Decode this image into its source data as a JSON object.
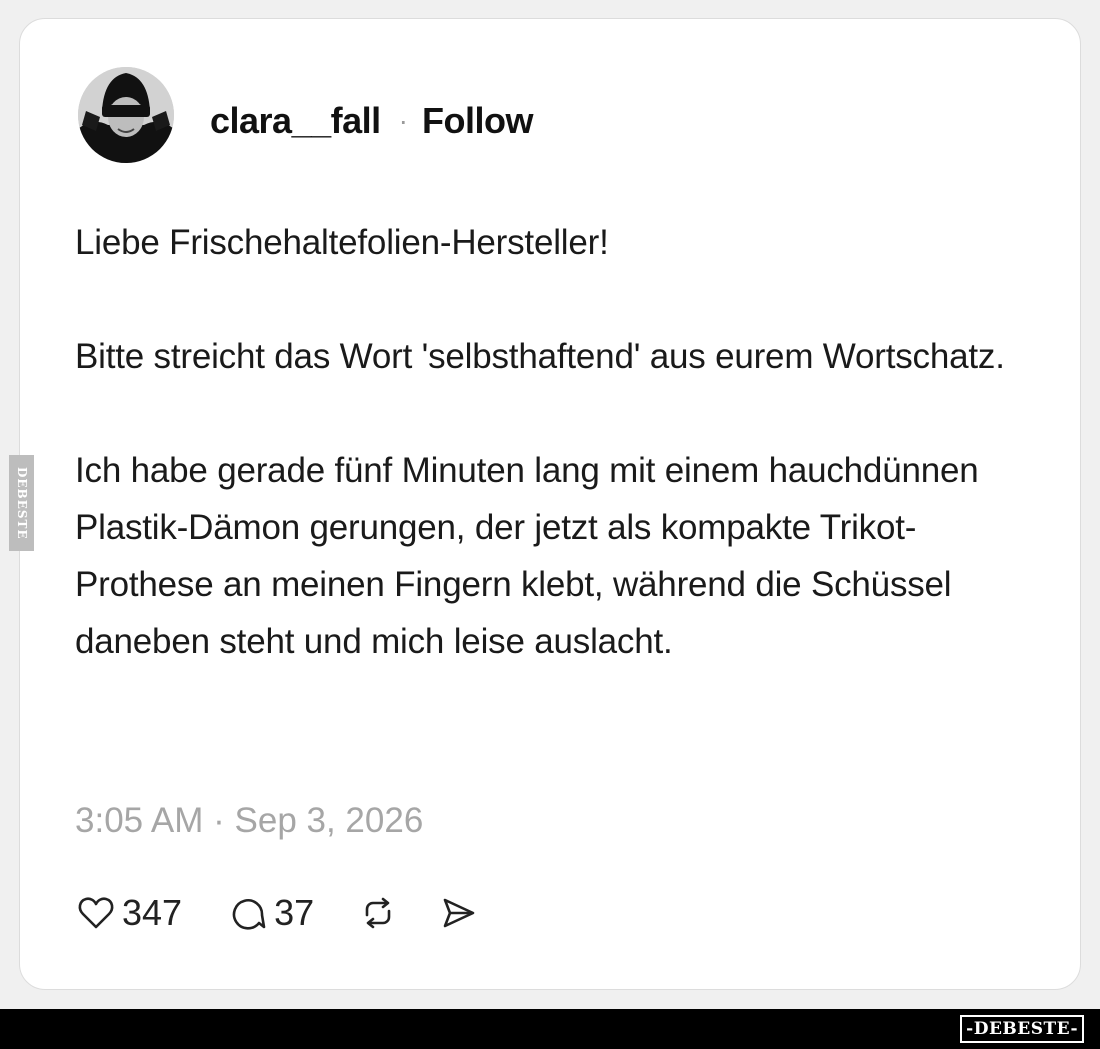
{
  "post": {
    "username": "clara__fall",
    "separator": "·",
    "follow_label": "Follow",
    "paragraphs": [
      "Liebe Frischehaltefolien-Hersteller!",
      "Bitte streicht das Wort 'selbsthaftend' aus eurem Wortschatz.",
      "Ich habe gerade fünf Minuten lang mit einem hauchdünnen Plastik-Dämon gerungen, der jetzt als kompakte Trikot-Prothese an meinen Fingern klebt, während die Schüssel daneben steht und mich leise auslacht."
    ],
    "timestamp": "3:05 AM · Sep 3, 2026"
  },
  "actions": {
    "likes": "347",
    "comments": "37",
    "icons": [
      "heart-icon",
      "comment-icon",
      "repost-icon",
      "share-icon"
    ]
  },
  "watermark": {
    "side_text": "DEBESTE",
    "logo_text": "-DEBESTE-"
  },
  "colors": {
    "card_background": "#ffffff",
    "page_background": "#f0f0f0",
    "text": "#111111",
    "muted": "#a6a6a6",
    "bar": "#000000"
  }
}
